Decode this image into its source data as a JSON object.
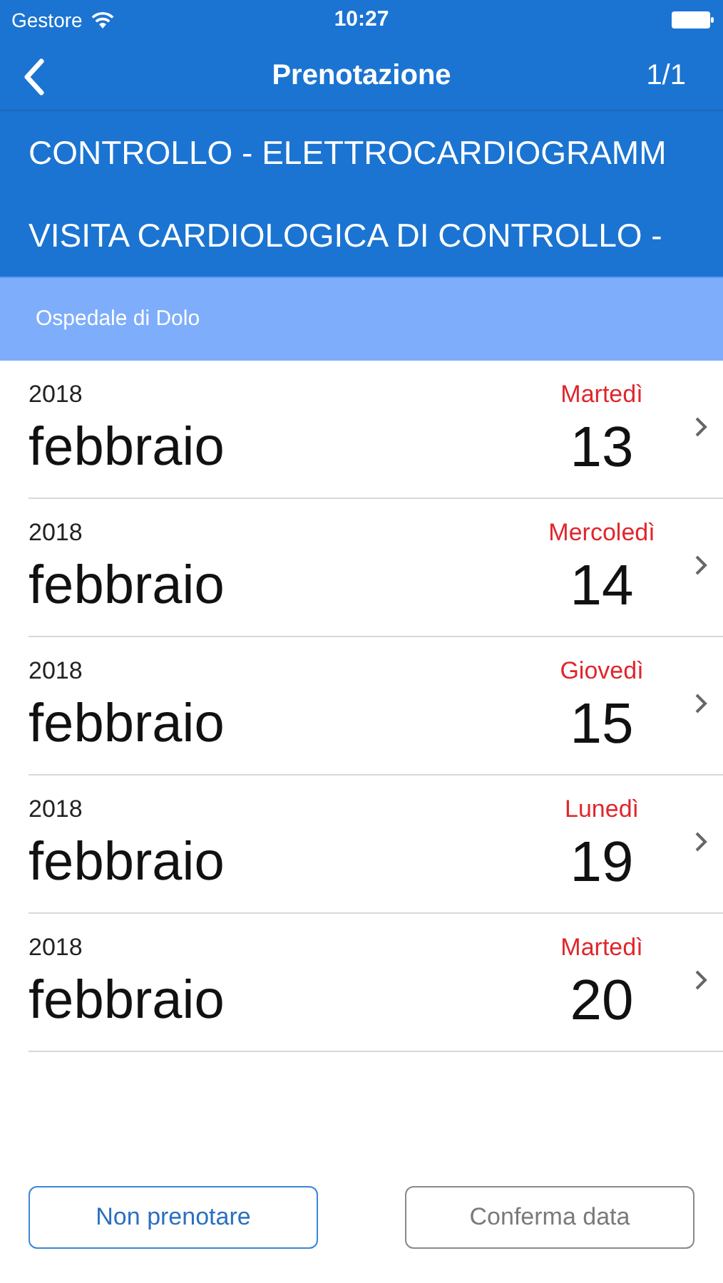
{
  "status_bar": {
    "carrier": "Gestore",
    "time": "10:27"
  },
  "nav": {
    "title": "Prenotazione",
    "counter": "1/1"
  },
  "services": [
    "CONTROLLO - ELETTROCARDIOGRAMM",
    "VISITA CARDIOLOGICA DI CONTROLLO -"
  ],
  "location": "Ospedale di Dolo",
  "dates": [
    {
      "year": "2018",
      "month": "febbraio",
      "weekday": "Martedì",
      "day": "13"
    },
    {
      "year": "2018",
      "month": "febbraio",
      "weekday": "Mercoledì",
      "day": "14"
    },
    {
      "year": "2018",
      "month": "febbraio",
      "weekday": "Giovedì",
      "day": "15"
    },
    {
      "year": "2018",
      "month": "febbraio",
      "weekday": "Lunedì",
      "day": "19"
    },
    {
      "year": "2018",
      "month": "febbraio",
      "weekday": "Martedì",
      "day": "20"
    }
  ],
  "buttons": [
    {
      "label": "Non prenotare",
      "disabled": false
    },
    {
      "label": "Conferma data",
      "disabled": true
    }
  ]
}
